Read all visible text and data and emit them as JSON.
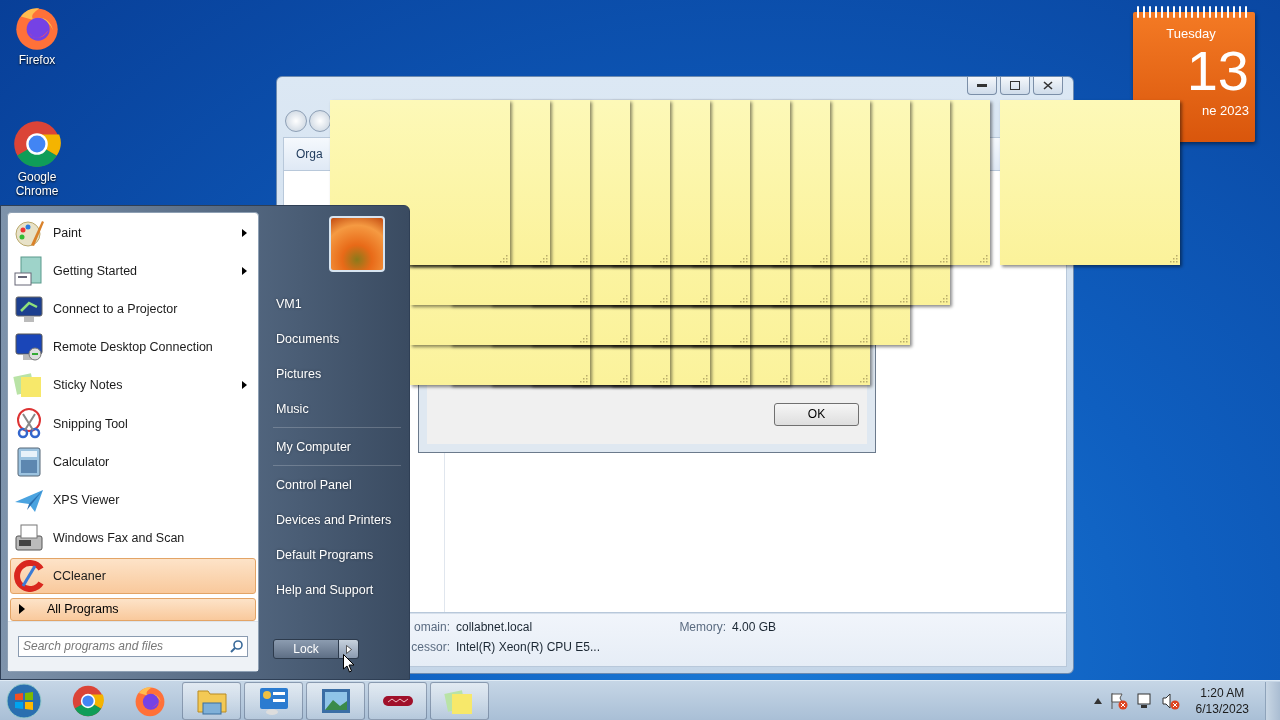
{
  "desktop_icons": [
    {
      "kind": "firefox",
      "label": "Firefox"
    },
    {
      "kind": "chrome",
      "label": "Google Chrome"
    }
  ],
  "calendar_gadget": {
    "weekday": "Tuesday",
    "day": "13",
    "month_year": "ne 2023"
  },
  "explorer_window": {
    "toolbar_button": "Orga",
    "details": [
      {
        "label": "omain:",
        "value": "collabnet.local"
      },
      {
        "label": "Memory:",
        "value": "4.00 GB"
      },
      {
        "label": "cessor:",
        "value": "Intel(R) Xeon(R) CPU E5..."
      }
    ]
  },
  "dialog": {
    "button": "OK"
  },
  "start_menu": {
    "programs": [
      {
        "kind": "paint",
        "label": "Paint",
        "submenu": true,
        "selected": false
      },
      {
        "kind": "getting-started",
        "label": "Getting Started",
        "submenu": true,
        "selected": false
      },
      {
        "kind": "projector",
        "label": "Connect to a Projector",
        "submenu": false,
        "selected": false
      },
      {
        "kind": "remote",
        "label": "Remote Desktop Connection",
        "submenu": false,
        "selected": false
      },
      {
        "kind": "sticky",
        "label": "Sticky Notes",
        "submenu": true,
        "selected": false
      },
      {
        "kind": "snipping",
        "label": "Snipping Tool",
        "submenu": false,
        "selected": false
      },
      {
        "kind": "calculator",
        "label": "Calculator",
        "submenu": false,
        "selected": false
      },
      {
        "kind": "xps",
        "label": "XPS Viewer",
        "submenu": false,
        "selected": false
      },
      {
        "kind": "fax",
        "label": "Windows Fax and Scan",
        "submenu": false,
        "selected": false
      },
      {
        "kind": "ccleaner",
        "label": "CCleaner",
        "submenu": false,
        "selected": true
      }
    ],
    "all_programs": "All Programs",
    "search": {
      "placeholder": "Search programs and files"
    },
    "places": [
      {
        "label": "VM1",
        "separator_after": false
      },
      {
        "label": "Documents",
        "separator_after": false
      },
      {
        "label": "Pictures",
        "separator_after": false
      },
      {
        "label": "Music",
        "separator_after": true
      },
      {
        "label": "My Computer",
        "separator_after": true
      },
      {
        "label": "Control Panel",
        "separator_after": false
      },
      {
        "label": "Devices and Printers",
        "separator_after": false
      },
      {
        "label": "Default Programs",
        "separator_after": false
      },
      {
        "label": "Help and Support",
        "separator_after": false
      }
    ],
    "power_button": "Lock"
  },
  "taskbar": {
    "items": [
      {
        "kind": "chrome",
        "running": false
      },
      {
        "kind": "firefox",
        "running": false
      },
      {
        "kind": "explorer",
        "running": true
      },
      {
        "kind": "control-panel",
        "running": true
      },
      {
        "kind": "photo-viewer",
        "running": true
      },
      {
        "kind": "red-app",
        "running": true
      },
      {
        "kind": "sticky",
        "running": true
      }
    ],
    "clock": {
      "time": "1:20 AM",
      "date": "6/13/2023"
    }
  }
}
